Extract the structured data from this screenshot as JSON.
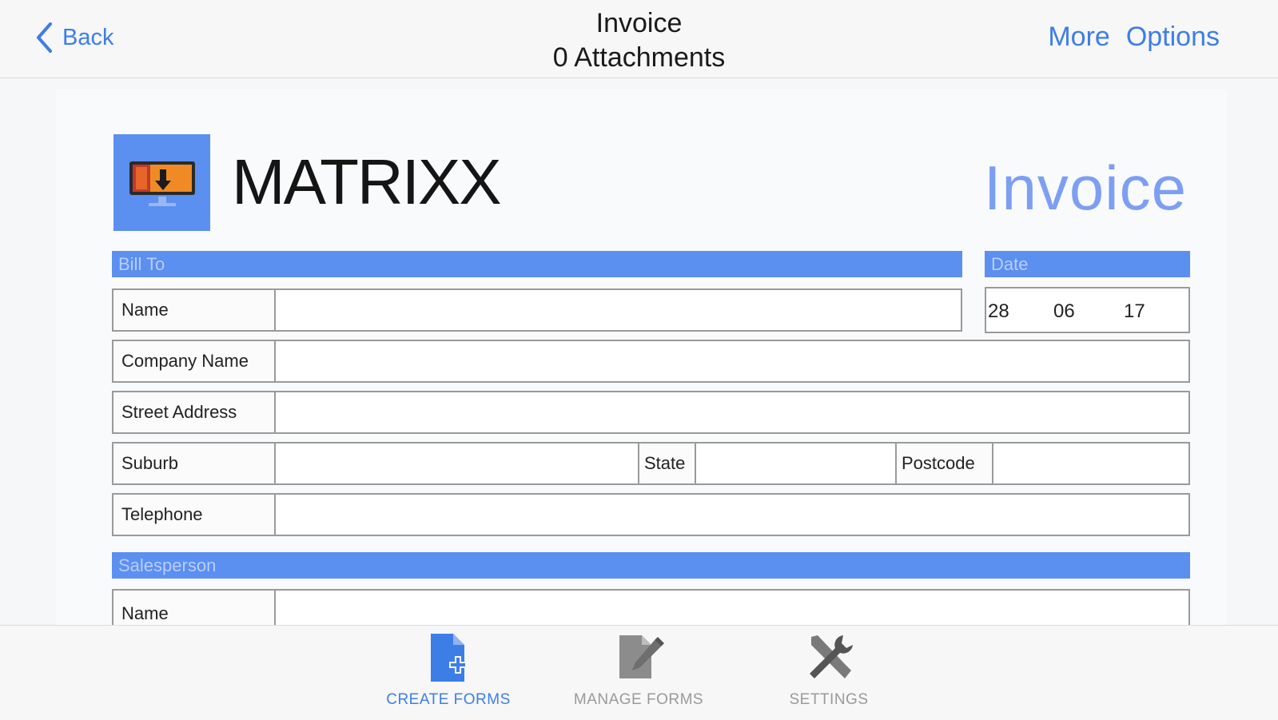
{
  "nav": {
    "back_label": "Back",
    "title": "Invoice",
    "subtitle": "0 Attachments",
    "more_label": "More",
    "options_label": "Options"
  },
  "form": {
    "brand": "MATRIXX",
    "doc_title": "Invoice",
    "bill_to_header": "Bill To",
    "date_header": "Date",
    "date": {
      "day": "28",
      "month": "06",
      "year": "17"
    },
    "name_label": "Name",
    "company_label": "Company Name",
    "street_label": "Street Address",
    "suburb_label": "Suburb",
    "state_label": "State",
    "postcode_label": "Postcode",
    "telephone_label": "Telephone",
    "salesperson_header": "Salesperson",
    "salesperson_name_label": "Name"
  },
  "tabs": [
    {
      "label": "CREATE FORMS",
      "icon": "create-forms-icon",
      "active": true
    },
    {
      "label": "MANAGE FORMS",
      "icon": "manage-forms-icon",
      "active": false
    },
    {
      "label": "SETTINGS",
      "icon": "settings-icon",
      "active": false
    }
  ],
  "colors": {
    "accent": "#3d7ee6",
    "section_bar": "#5b8ff0",
    "doc_title": "#7d9ff2",
    "inactive_tab": "#9a9a9a"
  }
}
